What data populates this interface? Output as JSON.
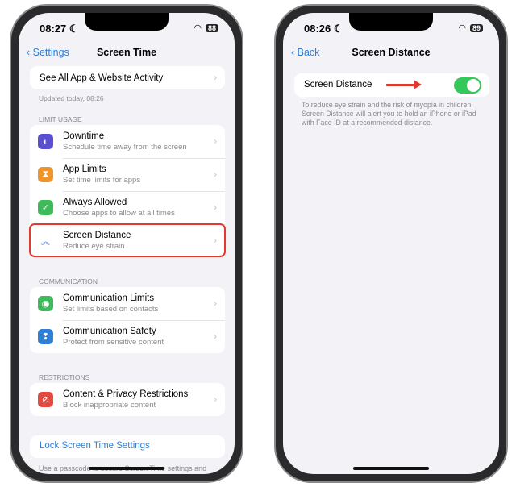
{
  "left": {
    "time": "08:27",
    "battery": "88",
    "back": "Settings",
    "title": "Screen Time",
    "activity": "See All App & Website Activity",
    "updated": "Updated today, 08:26",
    "limit_usage": "LIMIT USAGE",
    "limit_items": [
      {
        "title": "Downtime",
        "sub": "Schedule time away from the screen",
        "icon": "downtime-icon",
        "color": "#5b4fd1"
      },
      {
        "title": "App Limits",
        "sub": "Set time limits for apps",
        "icon": "hourglass-icon",
        "color": "#f0952b"
      },
      {
        "title": "Always Allowed",
        "sub": "Choose apps to allow at all times",
        "icon": "checkmark-icon",
        "color": "#3dbb5a"
      },
      {
        "title": "Screen Distance",
        "sub": "Reduce eye strain",
        "icon": "chevrons-up-icon",
        "color": "#3a74c9"
      }
    ],
    "communication": "COMMUNICATION",
    "comm_items": [
      {
        "title": "Communication Limits",
        "sub": "Set limits based on contacts",
        "icon": "person-icon",
        "color": "#3dbb5a"
      },
      {
        "title": "Communication Safety",
        "sub": "Protect from sensitive content",
        "icon": "chat-icon",
        "color": "#2f7fd6"
      }
    ],
    "restrictions": "RESTRICTIONS",
    "restr_items": [
      {
        "title": "Content & Privacy Restrictions",
        "sub": "Block inappropriate content",
        "icon": "no-entry-icon",
        "color": "#e04a40"
      }
    ],
    "lock": "Lock Screen Time Settings",
    "footer": "Use a passcode to secure Screen Time settings and"
  },
  "right": {
    "time": "08:26",
    "battery": "89",
    "back": "Back",
    "title": "Screen Distance",
    "toggle_label": "Screen Distance",
    "toggle_on": true,
    "description": "To reduce eye strain and the risk of myopia in children, Screen Distance will alert you to hold an iPhone or iPad with Face ID at a recommended distance."
  },
  "colors": {
    "highlight": "#e03a2e",
    "toggle": "#34c759",
    "link": "#2f7fd6"
  }
}
